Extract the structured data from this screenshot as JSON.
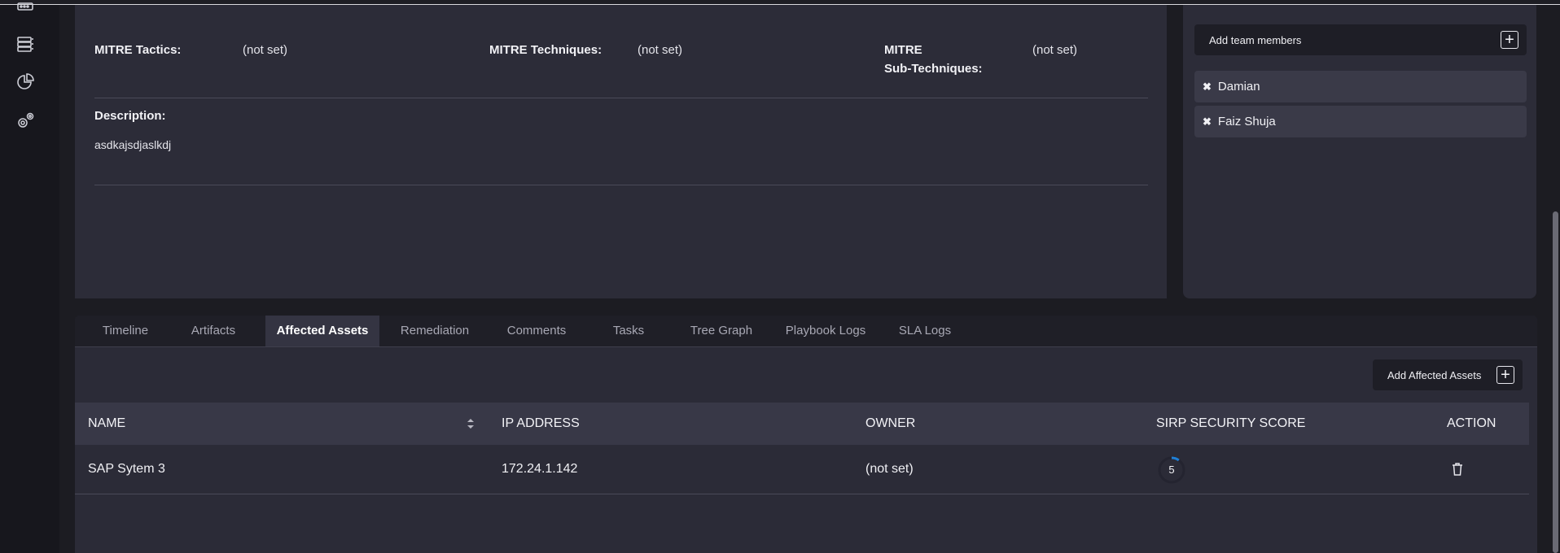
{
  "info": {
    "mitre_tactics_label": "MITRE Tactics:",
    "mitre_tactics_value": "(not set)",
    "mitre_techniques_label": "MITRE Techniques:",
    "mitre_techniques_value": "(not set)",
    "mitre_sub_label_1": "MITRE",
    "mitre_sub_label_2": "Sub-Techniques:",
    "mitre_sub_value": "(not set)",
    "description_label": "Description:",
    "description_value": "asdkajsdjaslkdj"
  },
  "team": {
    "add_label": "Add team members",
    "add_icon": "+",
    "remove_icon": "✖",
    "members": [
      "Damian",
      "Faiz Shuja"
    ]
  },
  "tabs": [
    {
      "label": "Timeline"
    },
    {
      "label": "Artifacts"
    },
    {
      "label": "Affected Assets"
    },
    {
      "label": "Remediation"
    },
    {
      "label": "Comments"
    },
    {
      "label": "Tasks"
    },
    {
      "label": "Tree Graph"
    },
    {
      "label": "Playbook Logs"
    },
    {
      "label": "SLA Logs"
    }
  ],
  "active_tab": "Affected Assets",
  "assets": {
    "add_label": "Add Affected Assets",
    "add_icon": "+",
    "columns": [
      "NAME",
      "IP ADDRESS",
      "OWNER",
      "SIRP SECURITY SCORE",
      "ACTION"
    ],
    "rows": [
      {
        "name": "SAP Sytem 3",
        "ip": "172.24.1.142",
        "owner": "(not set)",
        "score": "5"
      }
    ]
  },
  "colors": {
    "accent": "#1f7fd6",
    "panel": "#2c2c38",
    "background": "#1c1c22"
  },
  "sidebar_icons": [
    "server-icon",
    "database-list-icon",
    "pie-chart-icon",
    "settings-gears-icon"
  ]
}
